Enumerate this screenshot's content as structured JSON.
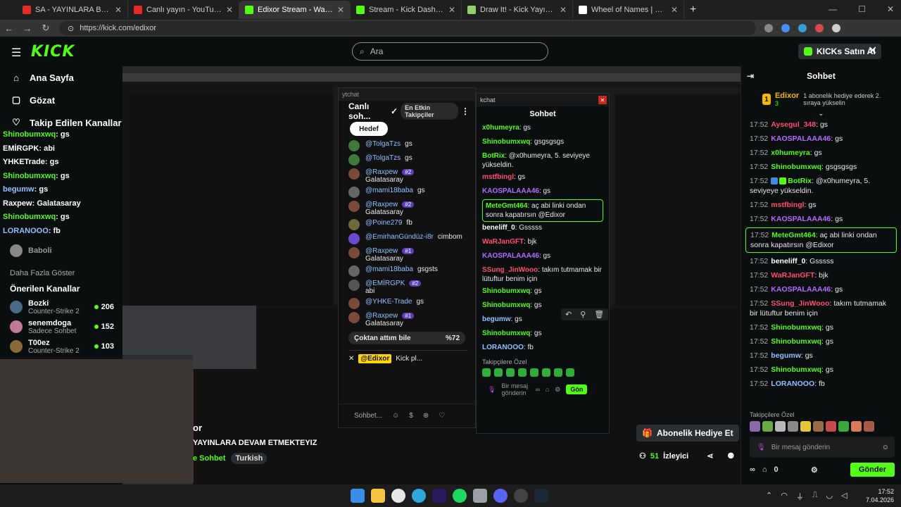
{
  "browser": {
    "tabs": [
      {
        "title": "SA - YAYINLARA BAŞLIYORUM - Yo",
        "color": "#e52d27",
        "active": false
      },
      {
        "title": "Canlı yayın - YouTube Studio",
        "color": "#e52d27",
        "active": false
      },
      {
        "title": "Edixor Stream - Watch Live on Kick",
        "color": "#53fc18",
        "active": true
      },
      {
        "title": "Stream - Kick Dashboard",
        "color": "#53fc18",
        "active": false
      },
      {
        "title": "Draw It! - Kick Yayıncıları İçin Çizim",
        "color": "#8fd26b",
        "active": false
      },
      {
        "title": "Wheel of Names | Random name p",
        "color": "#ffffff",
        "active": false
      }
    ],
    "new_tab": "+",
    "url": "https://kick.com/edixor"
  },
  "header": {
    "logo": "KICK",
    "search_placeholder": "Ara",
    "kicks_button": "KICKs Satın Al"
  },
  "sidebar": {
    "nav": [
      {
        "label": "Ana Sayfa",
        "icon": "⌂"
      },
      {
        "label": "Gözat",
        "icon": "▢"
      },
      {
        "label": "Takip Edilen Kanallar",
        "icon": "♡"
      }
    ],
    "followed": [
      {
        "name": "Baboli"
      }
    ],
    "more": "Daha Fazla Göster",
    "recommended_title": "Önerilen Kanallar",
    "recommended": [
      {
        "name": "Bozki",
        "category": "Counter-Strike 2",
        "viewers": "206"
      },
      {
        "name": "senemdoga",
        "category": "Sadece Sohbet",
        "viewers": "152"
      },
      {
        "name": "T00ez",
        "category": "Counter-Strike 2",
        "viewers": "103"
      }
    ],
    "overlay_msgs": [
      {
        "user": "Shinobumxwq",
        "text": "gs",
        "color": "#53fc18"
      },
      {
        "user": "EMİRGPK",
        "text": "abi",
        "color": "#ffffff"
      },
      {
        "user": "YHKETrade",
        "text": "gs",
        "color": "#ffffff"
      },
      {
        "user": "Shinobumxwq",
        "text": "gs",
        "color": "#53fc18"
      },
      {
        "user": "begumw",
        "text": "gs",
        "color": "#8fc1ff"
      },
      {
        "user": "Raxpew",
        "text": "Galatasaray",
        "color": "#ffffff"
      },
      {
        "user": "Shinobumxwq",
        "text": "gs",
        "color": "#53fc18"
      },
      {
        "user": "LORANOOO",
        "text": "fb",
        "color": "#8fc1ff"
      }
    ]
  },
  "stream": {
    "title": "or",
    "subtitle": "YAYINLARA DEVAM ETMEKTEYIZ",
    "category": "e Sohbet",
    "tag": "Turkish",
    "sub_gift": "Abonelik Hediye Et",
    "viewers": "51",
    "viewers_label": "İzleyici"
  },
  "ytchat": {
    "window_title": "ytchat",
    "title": "Canlı soh...",
    "chip": "En Etkin Takipçiler",
    "goal": "Hedef",
    "messages": [
      {
        "author": "@TolgaTzs",
        "badge": "",
        "text": "gs",
        "avatar": "#3f7a3a"
      },
      {
        "author": "@TolgaTzs",
        "badge": "",
        "text": "gs",
        "avatar": "#3f7a3a"
      },
      {
        "author": "@Raxpew",
        "badge": "#2",
        "text": "Galatasaray",
        "avatar": "#7a4b3a"
      },
      {
        "author": "@mami18baba",
        "badge": "",
        "text": "gs",
        "avatar": "#666666"
      },
      {
        "author": "@Raxpew",
        "badge": "#2",
        "text": "Galatasaray",
        "avatar": "#7a4b3a"
      },
      {
        "author": "@Poine279",
        "badge": "",
        "text": "fb",
        "avatar": "#6b6b3a"
      },
      {
        "author": "@EmirhanGündüz-i8r",
        "badge": "",
        "text": "cimbom",
        "avatar": "#6a4bd0"
      },
      {
        "author": "@Raxpew",
        "badge": "#1",
        "text": "Galatasaray",
        "avatar": "#7a4b3a"
      },
      {
        "author": "@mami18baba",
        "badge": "",
        "text": "gsgsts",
        "avatar": "#666666"
      },
      {
        "author": "@EMİRGPK",
        "badge": "#2",
        "text": "abi",
        "avatar": "#555555"
      },
      {
        "author": "@YHKE-Trade",
        "badge": "",
        "text": "gs",
        "avatar": "#7a4b3a"
      },
      {
        "author": "@Raxpew",
        "badge": "#1",
        "text": "Galatasaray",
        "avatar": "#7a4b3a"
      }
    ],
    "poll": {
      "label": "Çoktan attım bile",
      "pct": "%72"
    },
    "pinned": {
      "author": "@Edixor",
      "text": "Kick pl..."
    },
    "input_placeholder": "Sohbet..."
  },
  "kchat": {
    "window_title": "kchat",
    "title": "Sohbet",
    "messages": [
      {
        "user": "x0humeyra",
        "text": "gs",
        "color": "#53fc18",
        "hl": false
      },
      {
        "user": "Shinobumxwq",
        "text": "gsgsgsgs",
        "color": "#53fc18",
        "hl": false
      },
      {
        "user": "BotRix",
        "text": "@x0humeyra, 5. seviyeye yükseldin.",
        "color": "#53fc18",
        "hl": false
      },
      {
        "user": "mstfbingl",
        "text": "gs",
        "color": "#ff4d6d",
        "hl": false
      },
      {
        "user": "KAOSPALAAA46",
        "text": "gs",
        "color": "#b46bff",
        "hl": false
      },
      {
        "user": "MeteGmt464",
        "text": "aç abi linki ondan sonra kapatırsın @Edixor",
        "color": "#53fc18",
        "hl": true
      },
      {
        "user": "beneliff_0",
        "text": "Gsssss",
        "color": "#ffffff",
        "hl": false
      },
      {
        "user": "WaRJanGFT",
        "text": "bjk",
        "color": "#ff4d6d",
        "hl": false
      },
      {
        "user": "KAOSPALAAA46",
        "text": "gs",
        "color": "#b46bff",
        "hl": false
      },
      {
        "user": "SSung_JinWooo",
        "text": "takım tutmamak bir lütuftur benim için",
        "color": "#ff4d6d",
        "hl": false
      },
      {
        "user": "Shinobumxwq",
        "text": "gs",
        "color": "#53fc18",
        "hl": false
      },
      {
        "user": "Shinobumxwq",
        "text": "gs",
        "color": "#53fc18",
        "hl": false
      },
      {
        "user": "begumw",
        "text": "gs",
        "color": "#8fc1ff",
        "hl": false
      },
      {
        "user": "Shinobumxwq",
        "text": "gs",
        "color": "#53fc18",
        "hl": false
      },
      {
        "user": "LORANOOO",
        "text": "fb",
        "color": "#8fc1ff",
        "hl": false
      }
    ],
    "followers_label": "Takipçilere Özel",
    "input_placeholder": "Bir mesaj gönderin",
    "send": "Gön"
  },
  "chat": {
    "title": "Sohbet",
    "gift": {
      "user": "Edixor",
      "level": "3",
      "text": "1 abonelik hediye ederek 2. sıraya yükselin"
    },
    "messages": [
      {
        "time": "17:52",
        "user": "Aysegul_348",
        "text": "gs",
        "color": "#ff4d6d",
        "hl": false,
        "bot": false
      },
      {
        "time": "17:52",
        "user": "KAOSPALAAA46",
        "text": "gs",
        "color": "#b46bff",
        "hl": false,
        "bot": false
      },
      {
        "time": "17:52",
        "user": "x0humeyra",
        "text": "gs",
        "color": "#53fc18",
        "hl": false,
        "bot": false
      },
      {
        "time": "17:52",
        "user": "Shinobumxwq",
        "text": "gsgsgsgs",
        "color": "#53fc18",
        "hl": false,
        "bot": false
      },
      {
        "time": "17:52",
        "user": "BotRix",
        "text": "@x0humeyra, 5. seviyeye yükseldin.",
        "color": "#53fc18",
        "hl": false,
        "bot": true
      },
      {
        "time": "17:52",
        "user": "mstfbingl",
        "text": "gs",
        "color": "#ff4d6d",
        "hl": false,
        "bot": false
      },
      {
        "time": "17:52",
        "user": "KAOSPALAAA46",
        "text": "gs",
        "color": "#b46bff",
        "hl": false,
        "bot": false
      },
      {
        "time": "17:52",
        "user": "MeteGmt464",
        "text": "aç abi linki ondan sonra kapatırsın @Edixor",
        "color": "#53fc18",
        "hl": true,
        "bot": false
      },
      {
        "time": "17:52",
        "user": "beneliff_0",
        "text": "Gsssss",
        "color": "#ffffff",
        "hl": false,
        "bot": false
      },
      {
        "time": "17:52",
        "user": "WaRJanGFT",
        "text": "bjk",
        "color": "#ff4d6d",
        "hl": false,
        "bot": false
      },
      {
        "time": "17:52",
        "user": "KAOSPALAAA46",
        "text": "gs",
        "color": "#b46bff",
        "hl": false,
        "bot": false
      },
      {
        "time": "17:52",
        "user": "SSung_JinWooo",
        "text": "takım tutmamak bir lütuftur benim için",
        "color": "#ff4d6d",
        "hl": false,
        "bot": false
      },
      {
        "time": "17:52",
        "user": "Shinobumxwq",
        "text": "gs",
        "color": "#53fc18",
        "hl": false,
        "bot": false
      },
      {
        "time": "17:52",
        "user": "Shinobumxwq",
        "text": "gs",
        "color": "#53fc18",
        "hl": false,
        "bot": false
      },
      {
        "time": "17:52",
        "user": "begumw",
        "text": "gs",
        "color": "#8fc1ff",
        "hl": false,
        "bot": false
      },
      {
        "time": "17:52",
        "user": "Shinobumxwq",
        "text": "gs",
        "color": "#53fc18",
        "hl": false,
        "bot": false
      },
      {
        "time": "17:52",
        "user": "LORANOOO",
        "text": "fb",
        "color": "#8fc1ff",
        "hl": false,
        "bot": false
      }
    ],
    "followers_label": "Takipçilere Özel",
    "input_placeholder": "Bir mesaj gönderin",
    "points": "0",
    "send": "Gönder"
  },
  "taskbar": {
    "time": "17:52",
    "date": "7.04.2026"
  },
  "colors": {
    "accent": "#53fc18",
    "bg": "#0b0e0f"
  }
}
